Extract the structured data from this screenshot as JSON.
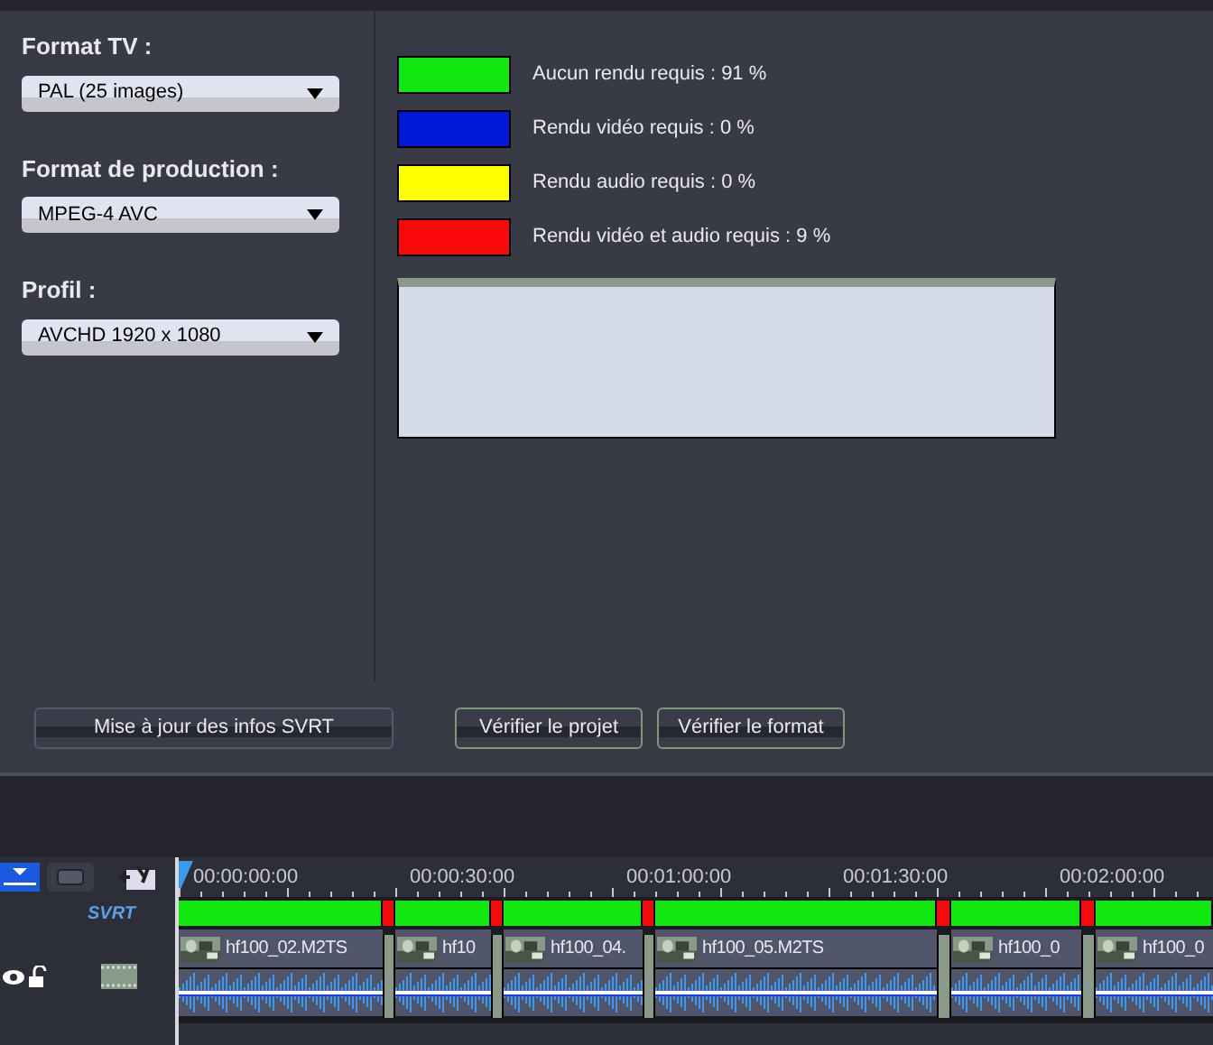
{
  "settings": [
    {
      "label": "Format TV :",
      "value": "PAL (25 images)"
    },
    {
      "label": "Format de production :",
      "value": "MPEG-4 AVC"
    },
    {
      "label": "Profil :",
      "value": "AVCHD 1920 x 1080"
    }
  ],
  "legend": [
    {
      "color": "#10e810",
      "text": "Aucun rendu requis : 91 %"
    },
    {
      "color": "#0018d8",
      "text": "Rendu vidéo requis : 0 %"
    },
    {
      "color": "#ffff00",
      "text": "Rendu audio requis : 0 %"
    },
    {
      "color": "#f80808",
      "text": "Rendu vidéo et audio requis : 9 %"
    }
  ],
  "buttons": [
    "Mise à jour des infos SVRT",
    "Vérifier le projet",
    "Vérifier le format"
  ],
  "timeline": {
    "ruler": [
      "00:00:00:00",
      "00:00:30:00",
      "00:01:00:00",
      "00:01:30:00",
      "00:02:00:00"
    ],
    "svrt_label": "SVRT",
    "svrt_segments": [
      {
        "color": "#10e810"
      },
      {
        "color": "#f80808"
      },
      {
        "color": "#10e810"
      },
      {
        "color": "#f80808"
      },
      {
        "color": "#10e810"
      },
      {
        "color": "#f80808"
      },
      {
        "color": "#10e810"
      },
      {
        "color": "#f80808"
      },
      {
        "color": "#10e810"
      },
      {
        "color": "#f80808"
      },
      {
        "color": "#10e810"
      }
    ],
    "clips": [
      {
        "name": "hf100_02.M2TS"
      },
      {
        "name": "hf10"
      },
      {
        "name": "hf100_04."
      },
      {
        "name": "hf100_05.M2TS"
      },
      {
        "name": "hf100_0"
      },
      {
        "name": "hf100_0"
      }
    ]
  }
}
